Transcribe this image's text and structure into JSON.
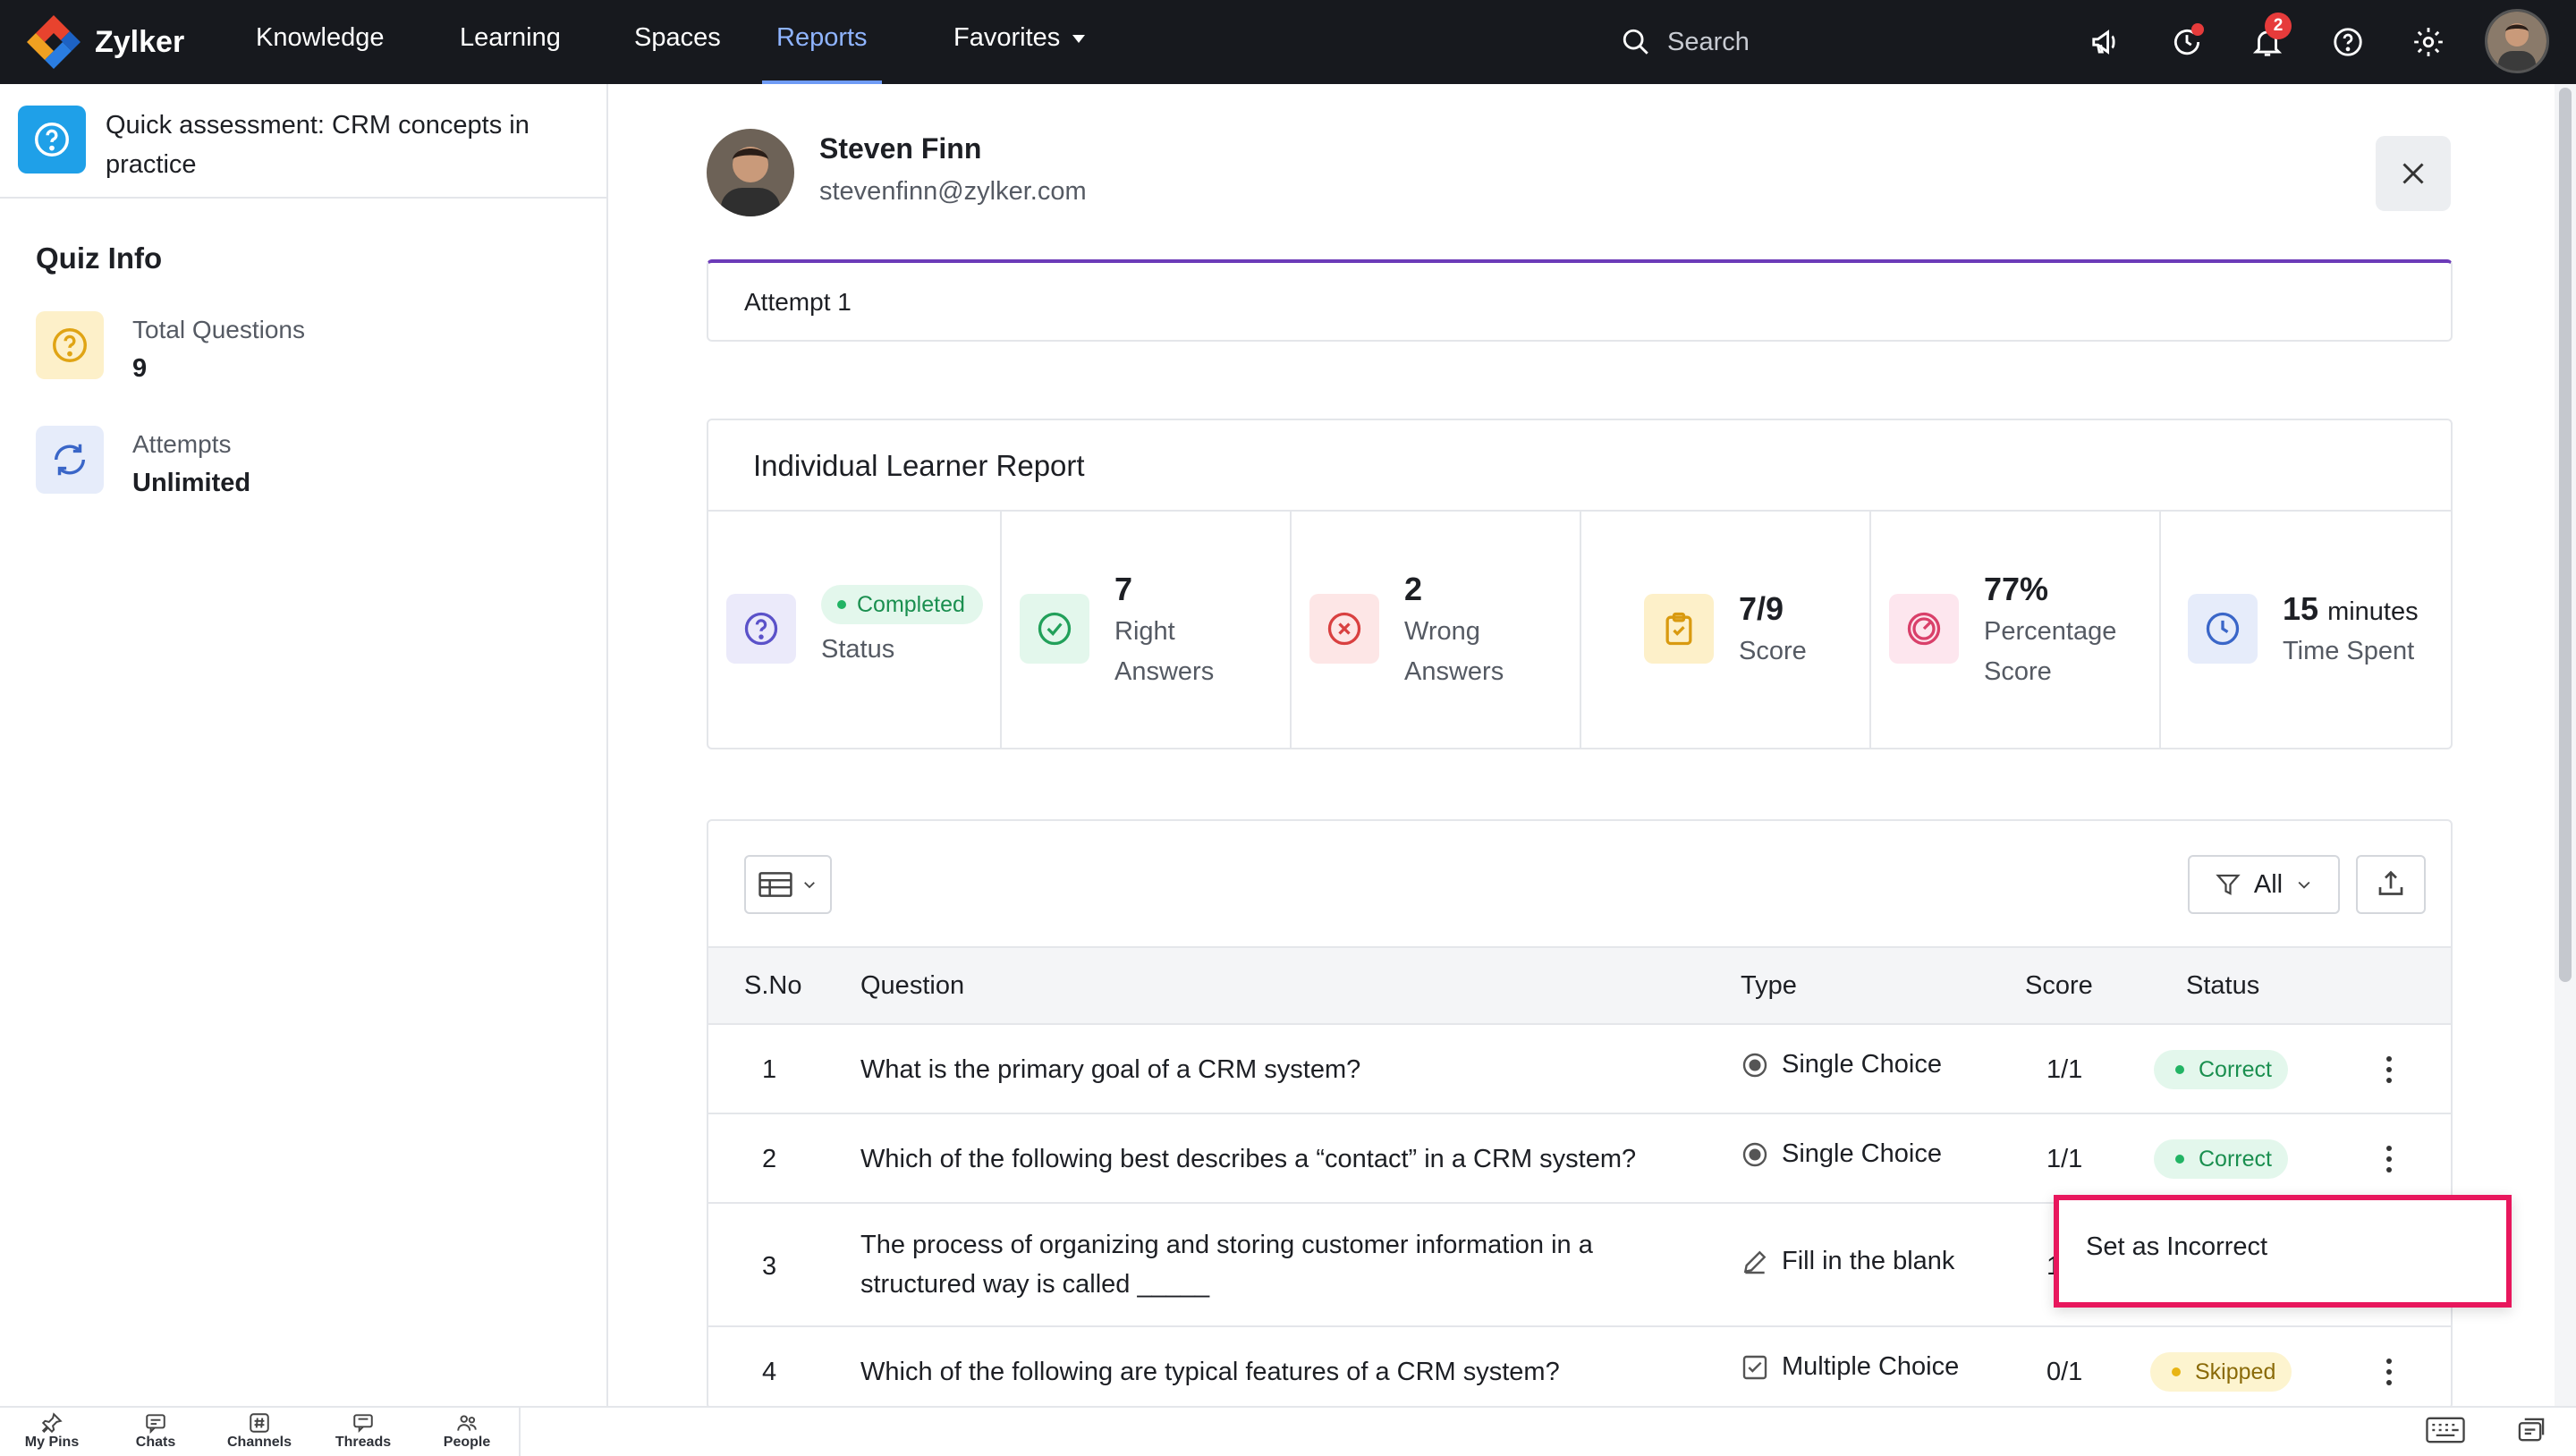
{
  "app": {
    "brand": "Zylker"
  },
  "nav": {
    "items": [
      {
        "label": "Knowledge"
      },
      {
        "label": "Learning"
      },
      {
        "label": "Spaces"
      },
      {
        "label": "Reports",
        "active": true
      },
      {
        "label": "Favorites",
        "has_dropdown": true
      }
    ],
    "search_placeholder": "Search",
    "notification_count": "2",
    "icons": [
      "announcement-icon",
      "reminder-icon",
      "bell-icon",
      "help-icon",
      "gear-icon",
      "user-avatar"
    ]
  },
  "sidebar": {
    "quiz_title": "Quick assessment: CRM concepts in practice",
    "info_title": "Quiz Info",
    "info": [
      {
        "label": "Total Questions",
        "value": "9",
        "icon": "question-icon"
      },
      {
        "label": "Attempts",
        "value": "Unlimited",
        "icon": "refresh-icon"
      }
    ]
  },
  "learner": {
    "name": "Steven Finn",
    "email": "stevenfinn@zylker.com"
  },
  "attempt": {
    "label": "Attempt 1"
  },
  "report": {
    "title": "Individual Learner Report",
    "stats": [
      {
        "key": "status",
        "value": "Completed",
        "label": "Status",
        "icon": "question-icon"
      },
      {
        "key": "right",
        "value": "7",
        "label": "Right Answers",
        "icon": "check-circle-icon"
      },
      {
        "key": "wrong",
        "value": "2",
        "label": "Wrong Answers",
        "icon": "x-circle-icon"
      },
      {
        "key": "score",
        "value": "7/9",
        "label": "Score",
        "icon": "clipboard-check-icon"
      },
      {
        "key": "percentage",
        "value": "77%",
        "label": "Percentage Score",
        "icon": "gauge-icon"
      },
      {
        "key": "time",
        "value": "15",
        "unit": "minutes",
        "label": "Time Spent",
        "icon": "clock-icon"
      }
    ]
  },
  "table": {
    "filter_label": "All",
    "columns": [
      "S.No",
      "Question",
      "Type",
      "Score",
      "Status"
    ],
    "rows": [
      {
        "sno": "1",
        "question": "What is the primary goal of a CRM system?",
        "type": "Single Choice",
        "type_icon": "radio-icon",
        "score": "1/1",
        "status": "Correct"
      },
      {
        "sno": "2",
        "question": "Which of the following best describes a “contact” in a CRM system?",
        "type": "Single Choice",
        "type_icon": "radio-icon",
        "score": "1/1",
        "status": "Correct"
      },
      {
        "sno": "3",
        "question": "The process of organizing and storing customer information in a structured way is called _____",
        "type": "Fill in the blank",
        "type_icon": "pencil-icon",
        "score": "1",
        "status": ""
      },
      {
        "sno": "4",
        "question": "Which of the following are typical features of a CRM system?",
        "type": "Multiple Choice",
        "type_icon": "checkbox-icon",
        "score": "0/1",
        "status": "Skipped"
      }
    ],
    "context_menu": {
      "item": "Set as Incorrect"
    }
  },
  "bottom_bar": {
    "items": [
      {
        "label": "My Pins",
        "icon": "pin-icon"
      },
      {
        "label": "Chats",
        "icon": "chat-icon"
      },
      {
        "label": "Channels",
        "icon": "hash-icon"
      },
      {
        "label": "Threads",
        "icon": "threads-icon"
      },
      {
        "label": "People",
        "icon": "people-icon"
      }
    ]
  },
  "colors": {
    "topbar": "#17191e",
    "accent": "#6f9bf5",
    "attempt_border": "#6c3bb8",
    "highlight": "#e8175d",
    "correct": "#22b464",
    "skipped": "#e8b414"
  }
}
